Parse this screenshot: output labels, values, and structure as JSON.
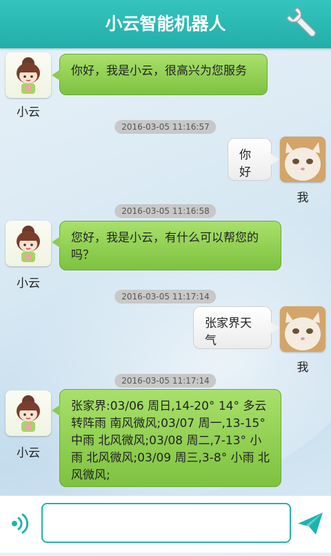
{
  "header": {
    "title": "小云智能机器人"
  },
  "bot": {
    "name": "小云"
  },
  "me": {
    "name": "我"
  },
  "messages": [
    {
      "text": "你好，我是小云，很高兴为您服务"
    },
    {
      "time": "2016-03-05 11:16:57",
      "text": "你好"
    },
    {
      "time": "2016-03-05 11:16:58",
      "text": "您好，我是小云，有什么可以帮您的吗？"
    },
    {
      "time": "2016-03-05 11:17:14",
      "text": "张家界天气"
    },
    {
      "time": "2016-03-05 11:17:14",
      "text": "张家界:03/06 周日,14-20° 14° 多云转阵雨 南风微风;03/07 周一,13-15° 中雨 北风微风;03/08 周二,7-13° 小雨 北风微风;03/09 周三,3-8° 小雨 北风微风;"
    }
  ],
  "input": {
    "value": "",
    "placeholder": ""
  },
  "colors": {
    "accent": "#22aeaa",
    "bot_bubble": "#8dcc4e",
    "me_bubble": "#ffffff"
  }
}
